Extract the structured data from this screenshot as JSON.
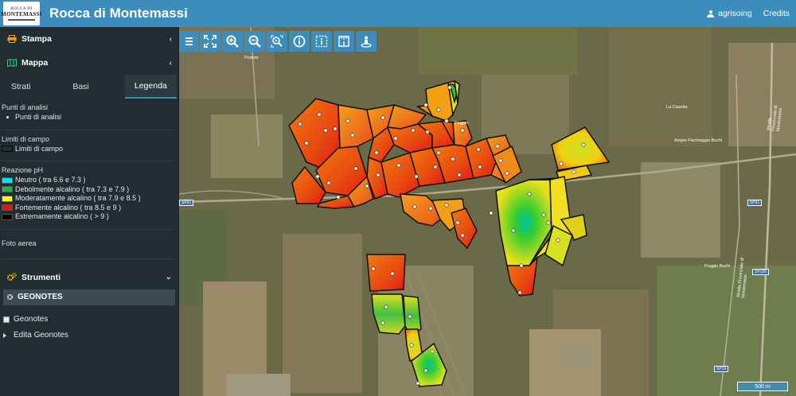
{
  "header": {
    "logo_text_top": "ROCCA DI",
    "logo_text_bottom": "MONTEMASSI",
    "title": "Rocca di Montemassi",
    "user_name": "agrisoing",
    "credits_label": "Credits",
    "bar_color": "#3c8dbc"
  },
  "sidebar": {
    "stampa_label": "Stampa",
    "mappa_label": "Mappa",
    "tabs": [
      {
        "label": "Strati",
        "active": false
      },
      {
        "label": "Basi",
        "active": false
      },
      {
        "label": "Legenda",
        "active": true
      }
    ],
    "legend": {
      "points_title": "Punti di analisi",
      "points_item": "Punti di analisi",
      "limits_title": "Limiti di campo",
      "limits_item": "Limiti di campo",
      "ph_title": "Reazione pH",
      "ph_items": [
        {
          "label": "Neutro ( tra 6.6 e 7.3 )",
          "color": "#00e0ff"
        },
        {
          "label": "Debolmente alcalino ( tra 7.3 e 7.9 )",
          "color": "#22b14c"
        },
        {
          "label": "Moderatamente alcalino ( tra 7.9 e 8.5 )",
          "color": "#ffff00"
        },
        {
          "label": "Fortemente alcalino ( tra 8.5 e 9 )",
          "color": "#e8141c"
        },
        {
          "label": "Estremamente alcalino ( > 9 )",
          "color": "#000000"
        }
      ],
      "aerial_title": "Foto aerea"
    },
    "strumenti_label": "Strumenti",
    "geonotes_header": "GEONOTES",
    "geonotes_item": "Geonotes",
    "edita_label": "Edita Geonotes"
  },
  "map": {
    "toolbar_icons": [
      "menu-icon",
      "fullscreen-icon",
      "zoom-in-icon",
      "zoom-out-icon",
      "zoom-extent-icon",
      "info-icon",
      "select-info-icon",
      "measure-icon",
      "streetview-icon"
    ],
    "scale_label": "500 m",
    "road_labels": [
      "SP91",
      "SP91",
      "SP156",
      "SP19"
    ],
    "place_labels": [
      "Podere",
      "Poggio",
      "La Casetta",
      "Ampio Parcheggio Buchi",
      "Poggio Buchi",
      "Strada Provinciale di Montemassi",
      "Strada Provinciale di Montemassi"
    ]
  }
}
